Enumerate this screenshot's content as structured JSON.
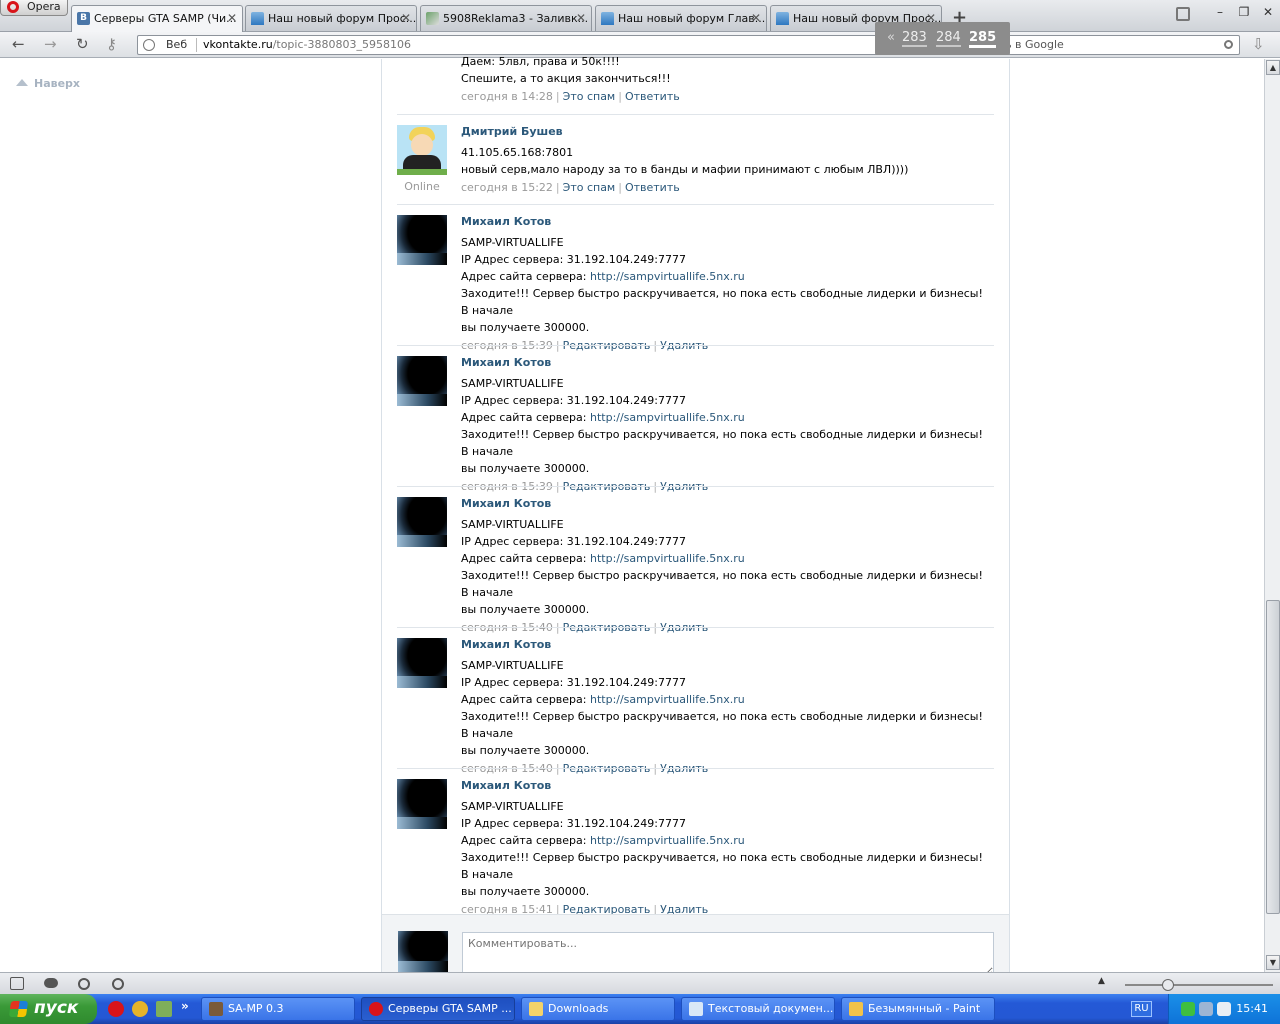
{
  "browser": {
    "menu_label": "Opera",
    "tabs": [
      {
        "title": "Серверы GTA SAMP (Чи..."
      },
      {
        "title": "Наш новый форум Прос..."
      },
      {
        "title": "5908Reklama3 - Заливк..."
      },
      {
        "title": "Наш новый форум Глав..."
      },
      {
        "title": "Наш новый форум Прос..."
      }
    ],
    "address": {
      "mode": "Веб",
      "host": "vkontakte.ru",
      "path": "/topic-3880803_5958106"
    },
    "search_placeholder": "Искать в Google"
  },
  "page": {
    "up_label": "Наверх",
    "pagination": {
      "prev": "«",
      "pages": [
        "283",
        "284",
        "285"
      ],
      "current": "285"
    },
    "first_post_tail": {
      "lines": [
        "Даем: 5лвл, права и 50к!!!!",
        "Спешите, а то акция закончиться!!!"
      ],
      "time": "сегодня в 14:28",
      "actions": [
        "Это спам",
        "Ответить"
      ]
    },
    "posts": [
      {
        "author": "Дмитрий Бушев",
        "status": "Online",
        "lines": [
          "41.105.65.168:7801",
          "новый серв,мало народу за то в банды и мафии принимают с любым ЛВЛ))))"
        ],
        "time": "сегодня в 15:22",
        "actions": [
          "Это спам",
          "Ответить"
        ]
      },
      {
        "author": "Михаил Котов",
        "line1": "SAMP-VIRTUALLIFE",
        "line2": "IP Адрес сервера: 31.192.104.249:7777",
        "site_label": "Адрес сайта сервера: ",
        "site_url": "http://sampvirtuallife.5nx.ru",
        "line4": "Заходите!!! Сервер быстро раскручивается, но пока есть свободные лидерки и бизнесы! В начале",
        "line5": "вы получаете 300000.",
        "time": "сегодня в 15:39",
        "actions": [
          "Редактировать",
          "Удалить"
        ]
      },
      {
        "author": "Михаил Котов",
        "line1": "SAMP-VIRTUALLIFE",
        "line2": "IP Адрес сервера: 31.192.104.249:7777",
        "site_label": "Адрес сайта сервера: ",
        "site_url": "http://sampvirtuallife.5nx.ru",
        "line4": "Заходите!!! Сервер быстро раскручивается, но пока есть свободные лидерки и бизнесы! В начале",
        "line5": "вы получаете 300000.",
        "time": "сегодня в 15:39",
        "actions": [
          "Редактировать",
          "Удалить"
        ]
      },
      {
        "author": "Михаил Котов",
        "line1": "SAMP-VIRTUALLIFE",
        "line2": "IP Адрес сервера: 31.192.104.249:7777",
        "site_label": "Адрес сайта сервера: ",
        "site_url": "http://sampvirtuallife.5nx.ru",
        "line4": "Заходите!!! Сервер быстро раскручивается, но пока есть свободные лидерки и бизнесы! В начале",
        "line5": "вы получаете 300000.",
        "time": "сегодня в 15:40",
        "actions": [
          "Редактировать",
          "Удалить"
        ]
      },
      {
        "author": "Михаил Котов",
        "line1": "SAMP-VIRTUALLIFE",
        "line2": "IP Адрес сервера: 31.192.104.249:7777",
        "site_label": "Адрес сайта сервера: ",
        "site_url": "http://sampvirtuallife.5nx.ru",
        "line4": "Заходите!!! Сервер быстро раскручивается, но пока есть свободные лидерки и бизнесы! В начале",
        "line5": "вы получаете 300000.",
        "time": "сегодня в 15:40",
        "actions": [
          "Редактировать",
          "Удалить"
        ]
      },
      {
        "author": "Михаил Котов",
        "line1": "SAMP-VIRTUALLIFE",
        "line2": "IP Адрес сервера: 31.192.104.249:7777",
        "site_label": "Адрес сайта сервера: ",
        "site_url": "http://sampvirtuallife.5nx.ru",
        "line4": "Заходите!!! Сервер быстро раскручивается, но пока есть свободные лидерки и бизнесы! В начале",
        "line5": "вы получаете 300000.",
        "time": "сегодня в 15:41",
        "actions": [
          "Редактировать",
          "Удалить"
        ]
      }
    ],
    "comment_placeholder": "Комментировать..."
  },
  "taskbar": {
    "start_label": "пуск",
    "tasks": [
      {
        "label": "SA-MP 0.3"
      },
      {
        "label": "Серверы GTA SAMP ..."
      },
      {
        "label": "Downloads"
      },
      {
        "label": "Текстовый докумен..."
      },
      {
        "label": "Безымянный - Paint"
      }
    ],
    "language": "RU",
    "clock": "15:41"
  },
  "colors": {
    "link": "#2b587a",
    "pager_bg": "#8c8c8c",
    "taskbar": "#2458d4",
    "start": "#3a9a38"
  }
}
